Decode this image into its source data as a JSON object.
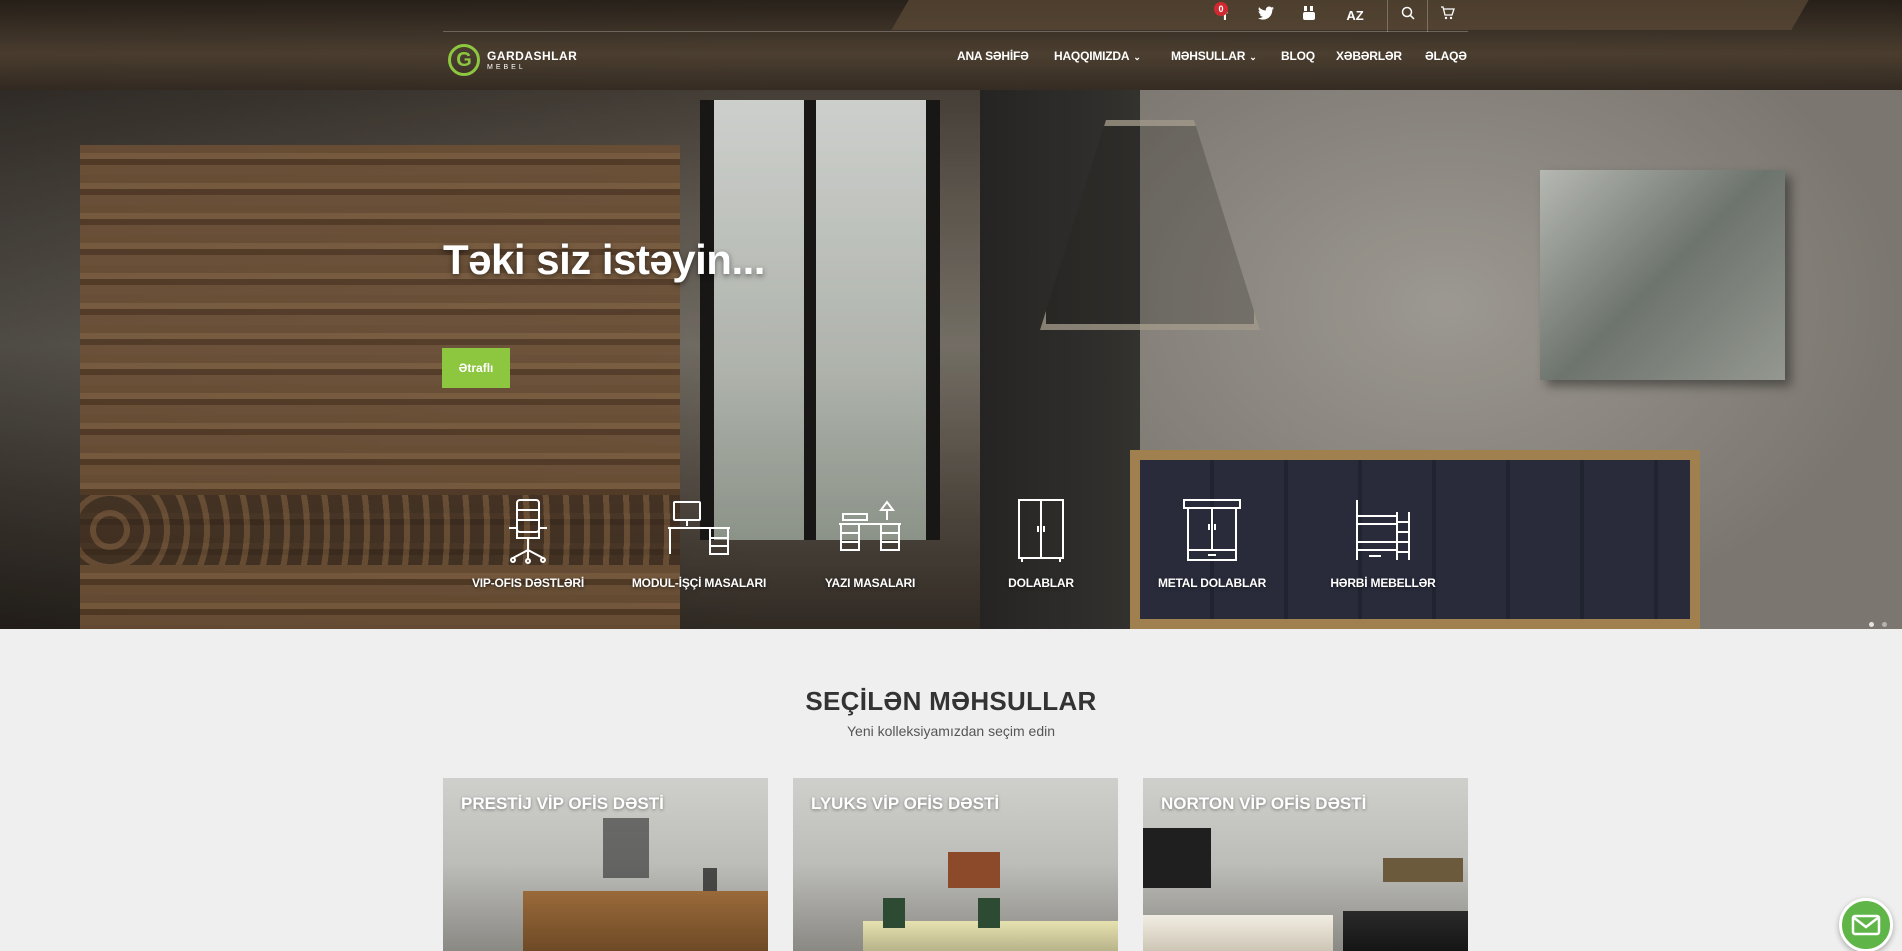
{
  "header": {
    "logo": {
      "brand": "GARDASHLAR",
      "sub": "MEBEL"
    },
    "topbar": {
      "social": [
        {
          "name": "facebook-icon",
          "glyph": "f"
        },
        {
          "name": "twitter-icon",
          "glyph": "t"
        },
        {
          "name": "youtube-icon",
          "glyph": "▶"
        }
      ],
      "language": "AZ",
      "cart_count": "0"
    },
    "nav": [
      {
        "label": "ANA SƏHİFƏ",
        "dropdown": false
      },
      {
        "label": "HAQQIMIZDA",
        "dropdown": true
      },
      {
        "label": "MƏHSULLAR",
        "dropdown": true
      },
      {
        "label": "BLOQ",
        "dropdown": false
      },
      {
        "label": "XƏBƏRLƏR",
        "dropdown": false
      },
      {
        "label": "ƏLAQƏ",
        "dropdown": false
      }
    ]
  },
  "hero": {
    "title": "Təki siz istəyin...",
    "button": "Ətraflı",
    "slides": 2,
    "active_slide": 1
  },
  "categories": [
    {
      "label": "VIP-OFIS DƏSTLƏRİ",
      "icon": "office-chair-icon"
    },
    {
      "label": "MODUL-İŞÇİ MASALARI",
      "icon": "computer-desk-icon"
    },
    {
      "label": "YAZI MASALARI",
      "icon": "writing-desk-icon"
    },
    {
      "label": "DOLABLAR",
      "icon": "wardrobe-icon"
    },
    {
      "label": "METAL DOLABLAR",
      "icon": "metal-cabinet-icon"
    },
    {
      "label": "HƏRBİ MEBELLƏR",
      "icon": "bunk-bed-icon"
    }
  ],
  "featured": {
    "title": "SEÇİLƏN MƏHSULLAR",
    "subtitle": "Yeni kolleksiyamızdan seçim edin",
    "items": [
      {
        "title": "PRESTİJ VİP OFİS DƏSTİ"
      },
      {
        "title": "LYUKS VİP OFİS DƏSTİ"
      },
      {
        "title": "NORTON VİP OFİS DƏSTİ"
      }
    ]
  },
  "colors": {
    "accent": "#8dc63f",
    "badge": "#d0292f",
    "mail": "#5fb548"
  }
}
